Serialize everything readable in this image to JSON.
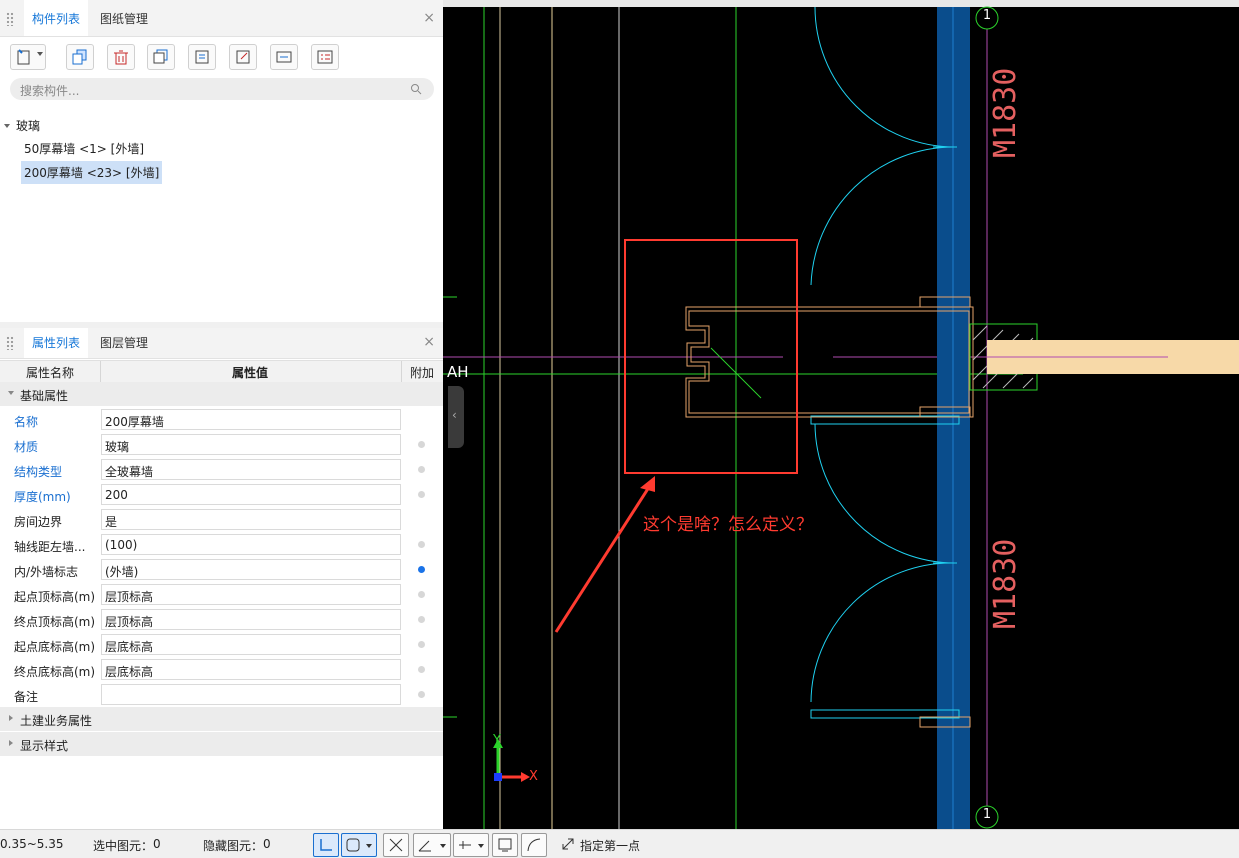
{
  "component_panel": {
    "tabs": [
      "构件列表",
      "图纸管理"
    ],
    "close": "×",
    "search_placeholder": "搜索构件...",
    "tree": {
      "group": "玻璃",
      "items": [
        "50厚幕墙 <1> [外墙]",
        "200厚幕墙 <23> [外墙]"
      ],
      "selected_index": 1
    },
    "toolbar_icons": [
      "new-component-icon",
      "copy-icon",
      "delete-icon",
      "copy-layer-icon",
      "layer-import-icon",
      "extract-icon",
      "rename-icon",
      "list-icon"
    ]
  },
  "property_panel": {
    "tabs": [
      "属性列表",
      "图层管理"
    ],
    "close": "×",
    "columns": [
      "属性名称",
      "属性值",
      "附加"
    ],
    "group_basic": "基础属性",
    "rows": [
      {
        "name": "名称",
        "value": "200厚幕墙",
        "blue": true,
        "dot": "none"
      },
      {
        "name": "材质",
        "value": "玻璃",
        "blue": true,
        "dot": "off"
      },
      {
        "name": "结构类型",
        "value": "全玻幕墙",
        "blue": true,
        "dot": "off"
      },
      {
        "name": "厚度(mm)",
        "value": "200",
        "blue": true,
        "dot": "off"
      },
      {
        "name": "房间边界",
        "value": "是",
        "blue": false,
        "dot": "none"
      },
      {
        "name": "轴线距左墙...",
        "value": "(100)",
        "blue": false,
        "dot": "off"
      },
      {
        "name": "内/外墙标志",
        "value": "(外墙)",
        "blue": false,
        "dot": "on"
      },
      {
        "name": "起点顶标高(m)",
        "value": "层顶标高",
        "blue": false,
        "dot": "off"
      },
      {
        "name": "终点顶标高(m)",
        "value": "层顶标高",
        "blue": false,
        "dot": "off"
      },
      {
        "name": "起点底标高(m)",
        "value": "层底标高",
        "blue": false,
        "dot": "off"
      },
      {
        "name": "终点底标高(m)",
        "value": "层底标高",
        "blue": false,
        "dot": "off"
      },
      {
        "name": "备注",
        "value": "",
        "blue": false,
        "dot": "off"
      }
    ],
    "group_civil": "土建业务属性",
    "group_display": "显示样式"
  },
  "canvas": {
    "axis_label_left": "AH",
    "axis_top": "1",
    "axis_bottom": "1",
    "door_tag_1": "M1830",
    "door_tag_2": "M1830",
    "annotation": "这个是啥？怎么定义？",
    "ucs_y": "Y",
    "ucs_x": "X",
    "colors": {
      "background": "#000000",
      "annotation": "#ff3b30",
      "wall": "#0a4d8c",
      "door_arc": "#1fd1f0"
    }
  },
  "status_bar": {
    "scale": "0.35~5.35",
    "selected_label": "选中图元：",
    "selected_count": "0",
    "hidden_label": "隐藏图元：",
    "hidden_count": "0",
    "prompt": "指定第一点"
  }
}
